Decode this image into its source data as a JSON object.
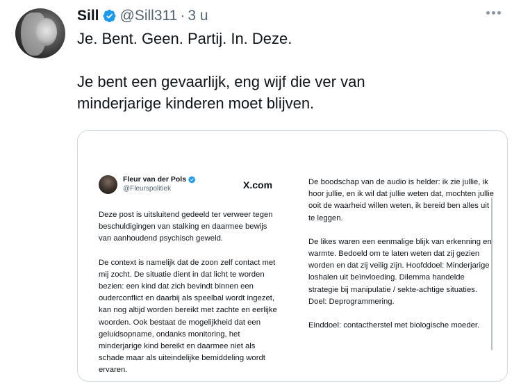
{
  "author": {
    "name": "Sill",
    "handle": "@Sill311",
    "separator": "·",
    "time": "3 u"
  },
  "tweet": {
    "line1": "Je. Bent. Geen. Partij. In. Deze.",
    "line2a": "Je bent een gevaarlijk, eng wijf die ver van",
    "line2b": "minderjarige kinderen moet blijven."
  },
  "screenshot": {
    "author_name": "Fleur van der Pols",
    "author_handle": "@Fleurspolitiek",
    "source": "X.com",
    "left_paragraphs": [
      "Deze post is uitsluitend gedeeld ter verweer tegen beschuldigingen van stalking en daarmee bewijs van aanhoudend psychisch geweld.",
      "De context is namelijk dat de zoon zelf contact met mij zocht. De situatie dient in dat licht te worden bezien: een kind dat zich bevindt binnen een ouderconflict en daarbij als speelbal wordt ingezet, kan nog altijd worden bereikt met zachte en eerlijke woorden. Ook bestaat de mogelijkheid dat een geluidsopname, ondanks monitoring, het minderjarige kind bereikt en daarmee niet als schade maar als uiteindelijke bemiddeling wordt ervaren."
    ],
    "right_paragraphs": [
      "De boodschap van de audio is helder: ik zie jullie, ik hoor jullie, en ik wil dat jullie weten dat, mochten jullie ooit de waarheid willen weten, ik bereid ben alles uit te leggen.",
      "De likes waren een eenmalige blijk van erkenning en warmte. Bedoeld om te laten weten dat zij gezien worden en dat zij veilig zijn. Hoofddoel: Minderjarige loshalen uit beïnvloeding. Dilemma handelde strategie bij manipulatie / sekte-achtige situaties. Doel: Deprogrammering.",
      "Einddoel: contactherstel met biologische moeder."
    ]
  },
  "colors": {
    "verified": "#1d9bf0",
    "secondary_text": "#536471",
    "border": "#cfd9de"
  }
}
